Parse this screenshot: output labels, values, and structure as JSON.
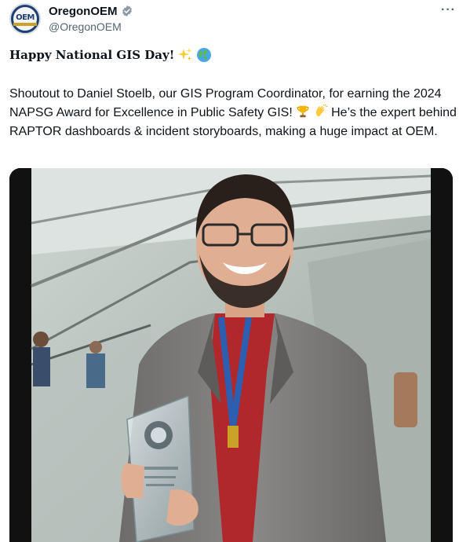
{
  "author": {
    "display_name": "OregonOEM",
    "handle": "@OregonOEM",
    "avatar_text": "OEM",
    "verified_icon": "verified-badge-icon"
  },
  "menu": {
    "more_label": "···"
  },
  "post": {
    "title": "Happy National GIS Day!",
    "title_emojis": [
      "sparkles-icon",
      "globe-icon"
    ],
    "body_part1": "Shoutout to Daniel Stoelb, our GIS Program Coordinator, for earning the 2024 NAPSG Award for Excellence in Public Safety GIS!",
    "body_emojis": [
      "trophy-icon",
      "clapping-hands-icon"
    ],
    "body_part2": "He’s the expert behind RAPTOR dashboards & incident storyboards, making a huge impact at OEM."
  },
  "media": {
    "type": "photo"
  },
  "colors": {
    "text": "#0f1419",
    "secondary": "#536471",
    "verified": "#8b98a5",
    "avatar_bg": "#1d3f72"
  }
}
